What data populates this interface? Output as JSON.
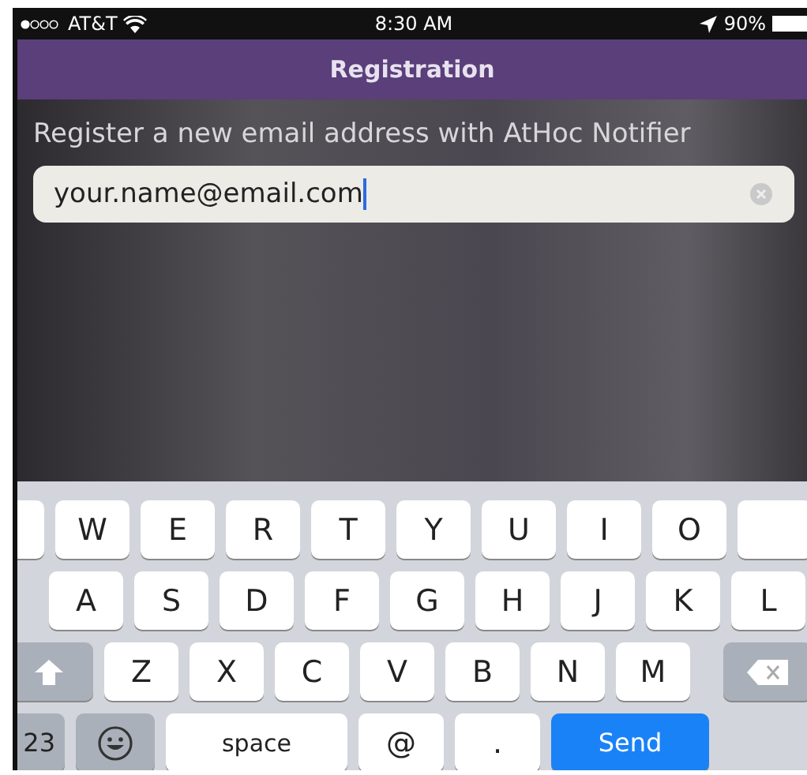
{
  "status_bar": {
    "carrier": "AT&T",
    "time": "8:30 AM",
    "battery": "90%"
  },
  "nav": {
    "title": "Registration"
  },
  "prompt": "Register a new email address with AtHoc Notifier",
  "email_field": {
    "value": "your.name@email.com"
  },
  "keyboard": {
    "top_keys": [
      {
        "kind": "cut"
      },
      {
        "kind": "letter",
        "label": "W"
      },
      {
        "kind": "letter",
        "label": "E"
      },
      {
        "kind": "letter",
        "label": "R"
      },
      {
        "kind": "letter",
        "label": "T"
      },
      {
        "kind": "letter",
        "label": "Y"
      },
      {
        "kind": "letter",
        "label": "U"
      },
      {
        "kind": "letter",
        "label": "I"
      },
      {
        "kind": "letter",
        "label": "O"
      },
      {
        "kind": "cut"
      }
    ],
    "home_keys": [
      {
        "kind": "letter",
        "label": "A"
      },
      {
        "kind": "letter",
        "label": "S"
      },
      {
        "kind": "letter",
        "label": "D"
      },
      {
        "kind": "letter",
        "label": "F"
      },
      {
        "kind": "letter",
        "label": "G"
      },
      {
        "kind": "letter",
        "label": "H"
      },
      {
        "kind": "letter",
        "label": "J"
      },
      {
        "kind": "letter",
        "label": "K"
      },
      {
        "kind": "letter",
        "label": "L"
      }
    ],
    "bottom_keys": [
      {
        "kind": "shift"
      },
      {
        "kind": "letter",
        "label": "Z"
      },
      {
        "kind": "letter",
        "label": "X"
      },
      {
        "kind": "letter",
        "label": "C"
      },
      {
        "kind": "letter",
        "label": "V"
      },
      {
        "kind": "letter",
        "label": "B"
      },
      {
        "kind": "letter",
        "label": "N"
      },
      {
        "kind": "letter",
        "label": "M"
      },
      {
        "kind": "delete"
      }
    ],
    "function_keys": [
      {
        "kind": "mode",
        "label": "23"
      },
      {
        "kind": "emoji"
      },
      {
        "kind": "space",
        "label": "space"
      },
      {
        "kind": "symbol",
        "label": "@"
      },
      {
        "kind": "symbol",
        "label": "."
      },
      {
        "kind": "send",
        "label": "Send"
      }
    ]
  }
}
